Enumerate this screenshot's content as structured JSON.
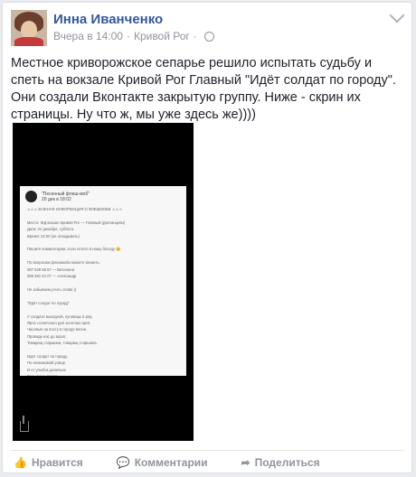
{
  "post": {
    "author": "Инна Иванченко",
    "time": "Вчера в 14:00",
    "location": "Кривой Рог",
    "text": "Местное криворожское сепарье решило испытать судьбу и спеть на вокзале Кривой Рог Главный \"Идёт солдат по городу\". Они создали Вконтакте закрытую группу. Ниже - скрин их страницы. Ну что ж, мы уже здесь же))))"
  },
  "screenshot": {
    "group_name": "\"Песенный флеш-моб\"",
    "group_date": "20 дек в 18:02",
    "lines": [
      "⚠⚠⚠ ВАЖНАЯ ИНФОРМАЦИЯ О ФЛЕШМОБЕ ⚠⚠⚠",
      "",
      "Место: ЖД вокзал Кривой Рог — Главный (Долгинцево)",
      "Дата: 24 декабря, суббота",
      "Время: 14:00 (не опаздывать)",
      "",
      "Пишите комментарии, если хотите в нашу беседу 😊",
      "",
      "По вопросам флешмоба можете звонить:",
      "067 528 58 67 — Виталина",
      "068 361 64 07 — Александр",
      "",
      "Не забываем учить слова ))",
      "",
      "\"Идёт солдат по городу\"",
      "",
      "У солдата выходной, пуговицы в ряд",
      "Ярче солнечного дня золотом горят.",
      "Часовые на посту в городе весна,",
      "Проводи нас до ворот,",
      "Товарищ старшина, товарищ старшина.",
      "",
      "Идёт солдат по городу,",
      "По незнакомой улице,",
      "И от улыбок девичьих",
      "Вся улица светла.",
      "Не обижайтесь, девушки,"
    ]
  },
  "actions": {
    "like": "Нравится",
    "comment": "Комментарии",
    "share": "Поделиться"
  }
}
